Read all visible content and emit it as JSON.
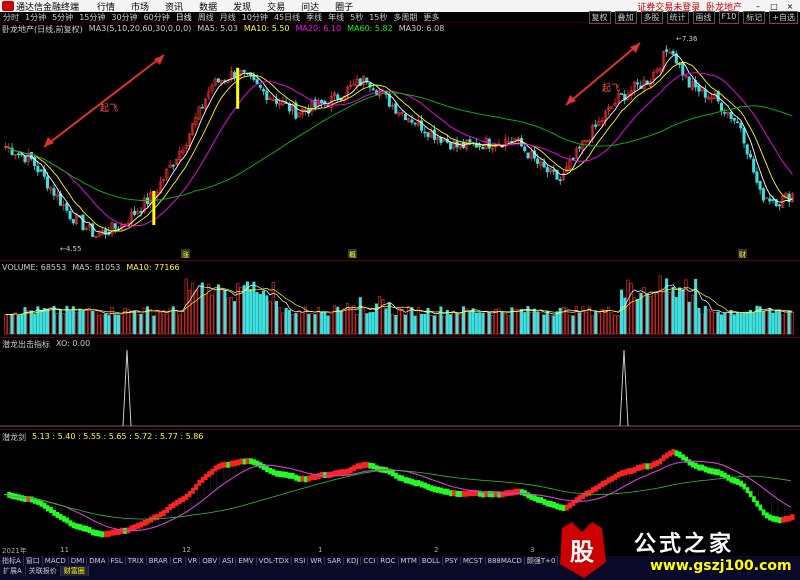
{
  "window": {
    "app_title": "通达信金融终端",
    "menu": [
      "行情",
      "市场",
      "资讯",
      "数据",
      "发现",
      "交易",
      "问达",
      "圈子"
    ],
    "right_note": "证券交易未登录",
    "stock_note": "卧龙地产"
  },
  "periods": [
    "分时",
    "1分钟",
    "5分钟",
    "15分钟",
    "30分钟",
    "60分钟",
    "日线",
    "周线",
    "月线",
    "10分钟",
    "45日线",
    "季线",
    "年线",
    "5秒",
    "15秒",
    "多周期",
    "更多"
  ],
  "active_period": "日线",
  "right_tools": [
    "复权",
    "叠加",
    "多股",
    "统计",
    "画线",
    "F10",
    "标记",
    "+自选"
  ],
  "main_info": {
    "name": "卧龙地产(日线,前复权)",
    "ma_def": "MA3(5,10,20,60,30,0,0,0)",
    "ma5": "MA5: 5.03",
    "ma10": "MA10: 5.50",
    "ma20": "MA20: 6.10",
    "ma60": "MA60: 5.82",
    "ma30": "MA30: 6.08"
  },
  "annotations": {
    "rise_left": "起飞",
    "rise_right": "起飞",
    "high_price": "7.36",
    "low_price": "4.55",
    "marker1": "涨",
    "marker2": "概",
    "marker3": "财"
  },
  "volume_info": {
    "label": "VOLUME: 68553",
    "ma5": "MA5: 81053",
    "ma10": "MA10: 77166"
  },
  "signal_info": {
    "label": "潜龙出击指标",
    "xo": "XO: 0.00"
  },
  "dragon_info": {
    "label": "潜龙剑",
    "values": "5.13 : 5.40 : 5.55 : 5.65 : 5.72 : 5.77 : 5.86"
  },
  "date_axis": [
    "2021年",
    "11",
    "12",
    "1",
    "2",
    "3"
  ],
  "indicator_tabs": [
    "指标A",
    "窗口",
    "MACD",
    "DMI",
    "DMA",
    "FSL",
    "TRIX",
    "BRAR",
    "CR",
    "VR",
    "OBV",
    "ASI",
    "EMV",
    "VOL-TDX",
    "RSI",
    "WR",
    "SAR",
    "KDJ",
    "CCI",
    "ROC",
    "MTM",
    "BOLL",
    "PSY",
    "MCST",
    "888MACD",
    "颇强T+0",
    "更多",
    "设置"
  ],
  "bottom_tabs": [
    "扩展A",
    "关联报价",
    "财富圈"
  ],
  "watermark": {
    "logo_char": "股",
    "text": "公式之家",
    "url": "www.gszj100.com"
  },
  "colors": {
    "up": "#ff3030",
    "down": "#3fe0e0",
    "ma5": "#ffffff",
    "ma10": "#ffff00",
    "ma20": "#ff00ff",
    "ma60": "#00c000"
  }
}
